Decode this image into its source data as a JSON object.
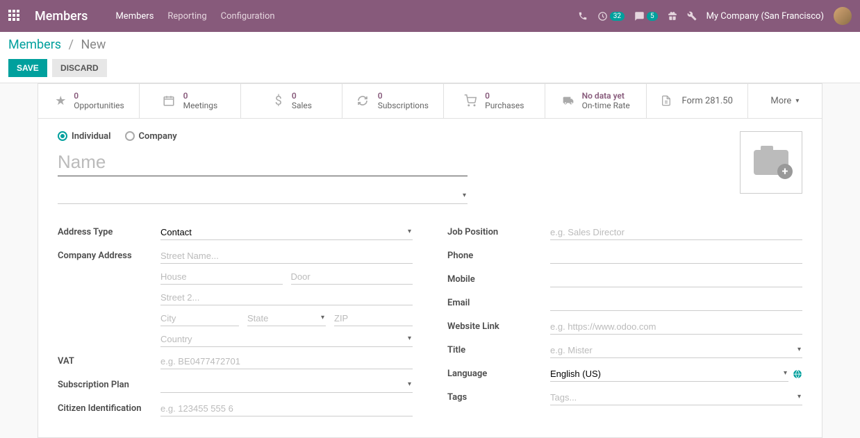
{
  "navbar": {
    "brand": "Members",
    "links": [
      "Members",
      "Reporting",
      "Configuration"
    ],
    "activity_badge": "32",
    "msg_badge": "5",
    "company": "My Company (San Francisco)"
  },
  "breadcrumb": {
    "root": "Members",
    "current": "New"
  },
  "buttons": {
    "save": "SAVE",
    "discard": "DISCARD"
  },
  "stats": {
    "opportunities": {
      "value": "0",
      "label": "Opportunities"
    },
    "meetings": {
      "value": "0",
      "label": "Meetings"
    },
    "sales": {
      "value": "0",
      "label": "Sales"
    },
    "subscriptions": {
      "value": "0",
      "label": "Subscriptions"
    },
    "purchases": {
      "value": "0",
      "label": "Purchases"
    },
    "ontime": {
      "value": "No data yet",
      "label": "On-time Rate"
    },
    "form281": "Form 281.50",
    "more": "More"
  },
  "type": {
    "individual": "Individual",
    "company": "Company"
  },
  "name_placeholder": "Name",
  "labels": {
    "address_type": "Address Type",
    "company_address": "Company Address",
    "vat": "VAT",
    "subscription_plan": "Subscription Plan",
    "citizen_id": "Citizen Identification",
    "job_position": "Job Position",
    "phone": "Phone",
    "mobile": "Mobile",
    "email": "Email",
    "website": "Website Link",
    "title": "Title",
    "language": "Language",
    "tags": "Tags"
  },
  "values": {
    "address_type": "Contact",
    "language": "English (US)"
  },
  "placeholders": {
    "street": "Street Name...",
    "house": "House",
    "door": "Door",
    "street2": "Street 2...",
    "city": "City",
    "state": "State",
    "zip": "ZIP",
    "country": "Country",
    "vat": "e.g. BE0477472701",
    "citizen_id": "e.g. 123455 555 6",
    "job_position": "e.g. Sales Director",
    "website": "e.g. https://www.odoo.com",
    "title": "e.g. Mister",
    "tags": "Tags..."
  }
}
